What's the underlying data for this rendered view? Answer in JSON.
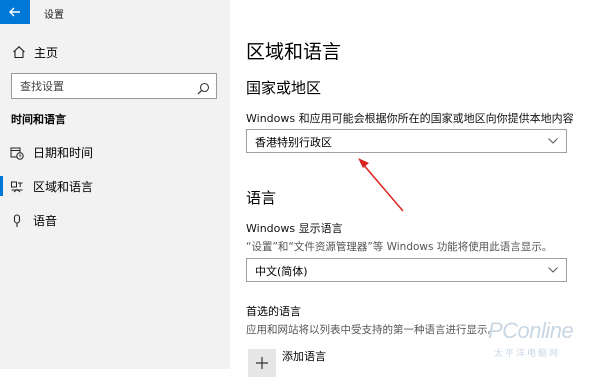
{
  "window": {
    "title": "设置"
  },
  "sidebar": {
    "home_label": "主页",
    "search_placeholder": "查找设置",
    "section_title": "时间和语言",
    "items": [
      {
        "label": "日期和时间",
        "icon": "calendar-clock-icon",
        "selected": false
      },
      {
        "label": "区域和语言",
        "icon": "region-icon",
        "selected": true
      },
      {
        "label": "语音",
        "icon": "microphone-icon",
        "selected": false
      }
    ]
  },
  "main": {
    "page_title": "区域和语言",
    "country": {
      "heading": "国家或地区",
      "description": "Windows 和应用可能会根据你所在的国家或地区向你提供本地内容",
      "selected": "香港特别行政区"
    },
    "language": {
      "heading": "语言",
      "display_label": "Windows 显示语言",
      "display_description": "“设置”和“文件资源管理器”等 Windows 功能将使用此语言显示。",
      "display_selected": "中文(简体)",
      "preferred_title": "首选的语言",
      "preferred_description": "应用和网站将以列表中受支持的第一种语言进行显示。",
      "add_language_label": "添加语言"
    }
  },
  "watermark": {
    "logo": "PConline",
    "sub": "太平洋电脑网"
  },
  "colors": {
    "accent": "#0078d7",
    "annotation_arrow": "#d9241e"
  }
}
